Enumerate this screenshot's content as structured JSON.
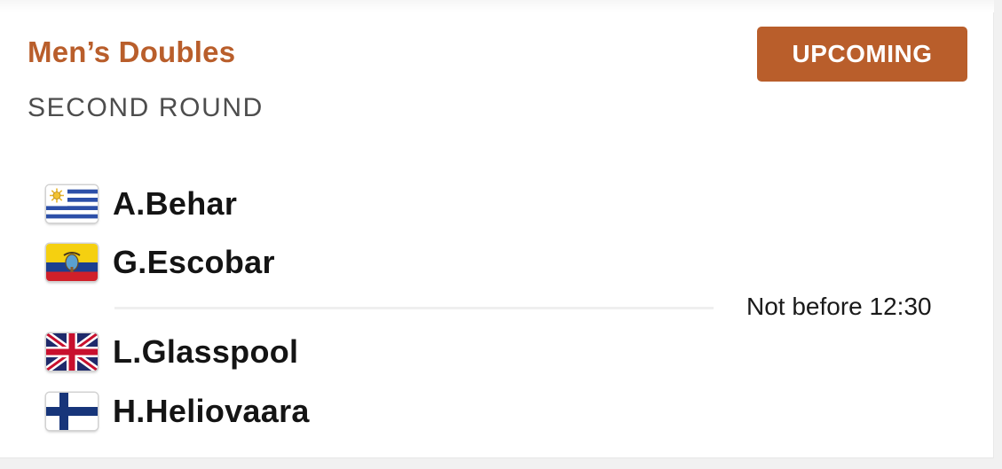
{
  "match": {
    "event": "Men’s Doubles",
    "round": "SECOND ROUND",
    "status": "UPCOMING",
    "schedule": "Not before 12:30",
    "colors": {
      "accent": "#b95e2b",
      "name_text": "#141414",
      "round_text": "#4d4d4d"
    },
    "teams": [
      {
        "players": [
          {
            "name": "A.Behar",
            "flag_icon": "uruguay-flag-icon"
          },
          {
            "name": "G.Escobar",
            "flag_icon": "ecuador-flag-icon"
          }
        ]
      },
      {
        "players": [
          {
            "name": "L.Glasspool",
            "flag_icon": "united-kingdom-flag-icon"
          },
          {
            "name": "H.Heliovaara",
            "flag_icon": "finland-flag-icon"
          }
        ]
      }
    ]
  }
}
